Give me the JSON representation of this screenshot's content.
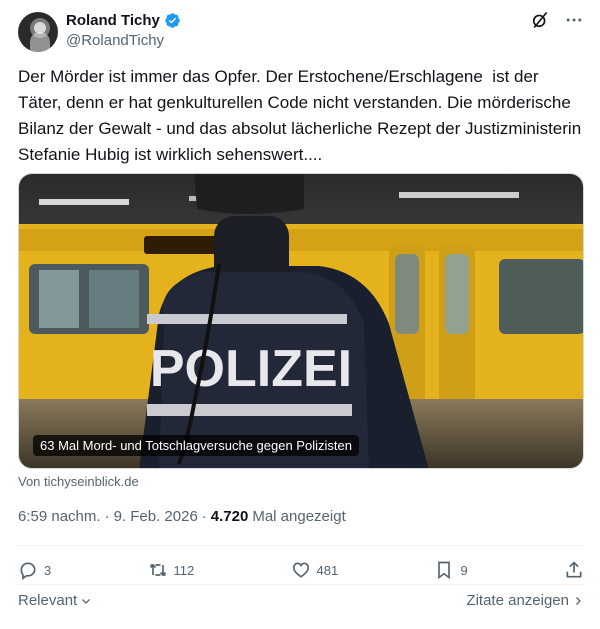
{
  "author": {
    "display_name": "Roland Tichy",
    "handle": "@RolandTichy",
    "verified": true
  },
  "tweet": {
    "text": "Der Mörder ist immer das Opfer. Der Erstochene/Erschlagene  ist der Täter, denn er hat genkulturellen Code nicht verstanden. Die mörderische Bilanz der Gewalt - und das absolut lächerliche Rezept der Justizministerin Stefanie Hubig ist wirklich sehenswert...."
  },
  "card": {
    "image_text": "POLIZEI",
    "caption": "63 Mal Mord- und Totschlagversuche gegen Polizisten",
    "source": "Von tichyseinblick.de"
  },
  "meta": {
    "time": "6:59 nachm.",
    "separator1": "·",
    "date": "9. Feb. 2026",
    "separator2": "·",
    "views": "4.720",
    "views_label": "Mal angezeigt"
  },
  "actions": {
    "replies": "3",
    "reposts": "112",
    "likes": "481",
    "bookmarks": "9"
  },
  "footer": {
    "sort_label": "Relevant",
    "quotes_label": "Zitate anzeigen"
  },
  "colors": {
    "accent": "#1d9bf0",
    "text_primary": "#0f1419",
    "text_secondary": "#536471",
    "tram_yellow": "#e8b720"
  },
  "icons": [
    "verified-badge-icon",
    "grok-icon",
    "more-icon",
    "reply-icon",
    "repost-icon",
    "like-icon",
    "bookmark-icon",
    "share-icon",
    "chevron-down-icon",
    "chevron-right-icon"
  ]
}
